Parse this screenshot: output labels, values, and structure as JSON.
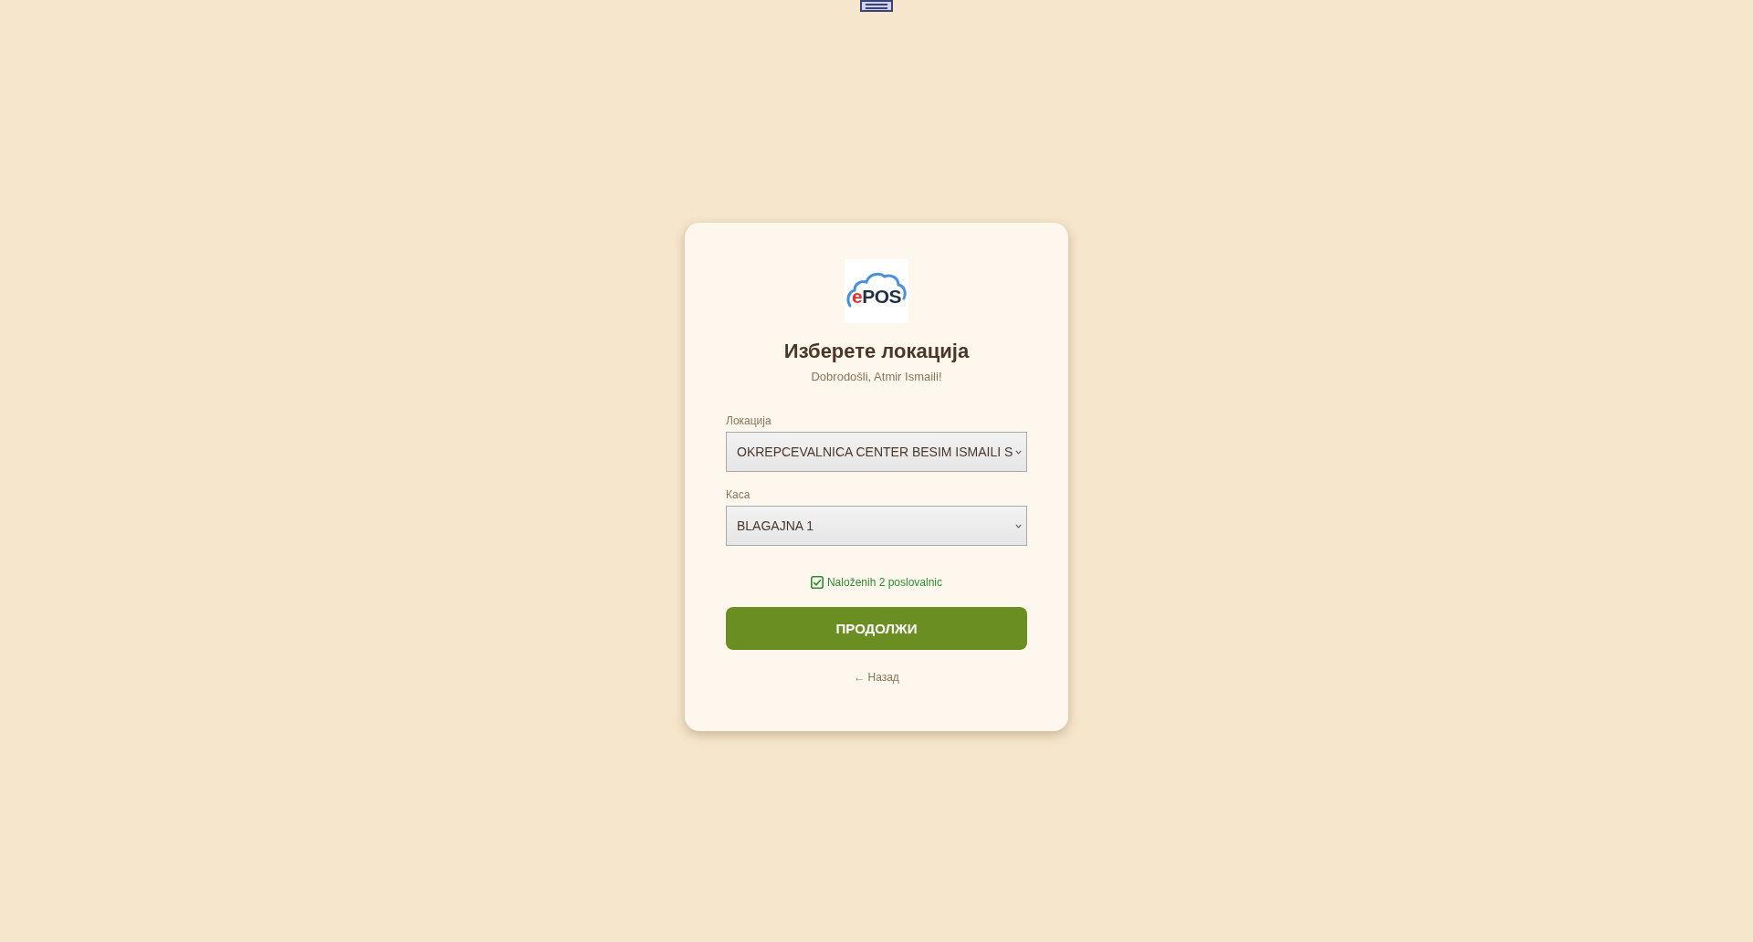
{
  "logo": {
    "accent": "e",
    "text": "POS"
  },
  "title": "Изберете локација",
  "subtitle": "Dobrodošli, Atmir Ismaili!",
  "fields": [
    {
      "label": "Локација",
      "value": "OKREPCEVALNICA CENTER BESIM ISMAILI S"
    },
    {
      "label": "Каса",
      "value": "BLAGAJNA 1"
    }
  ],
  "status": {
    "checked": true,
    "text": "Naloženih 2 poslovalnic"
  },
  "button": {
    "label": "ПРОДОЛЖИ"
  },
  "back_link": "← Назад"
}
